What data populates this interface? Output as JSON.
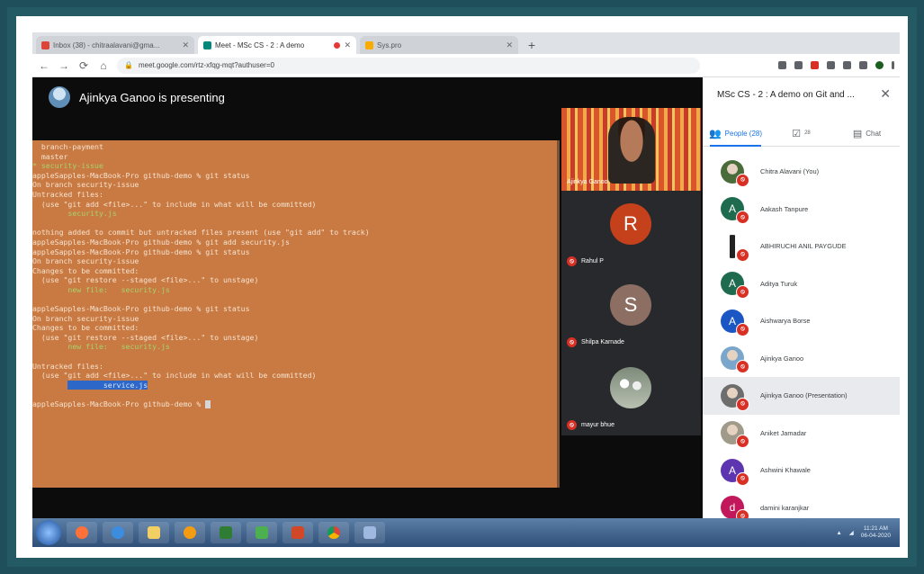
{
  "browser": {
    "tabs": [
      {
        "label": "Inbox (38) - chitraalavani@gma...",
        "favicon_color": "#db4437",
        "active": false
      },
      {
        "label": "Meet - MSc CS - 2 : A demo",
        "favicon_color": "#00897b",
        "active": true,
        "recording": true
      },
      {
        "label": "Sys.pro",
        "favicon_color": "#f9ab00",
        "active": false
      }
    ],
    "url": "meet.google.com/rtz-xfqg-mqt?authuser=0"
  },
  "meet": {
    "presenting_text": "Ajinkya Ganoo is presenting",
    "terminal_lines": [
      {
        "text": "  branch-payment",
        "style": "normal"
      },
      {
        "text": "  master",
        "style": "normal"
      },
      {
        "text": "* security-issue",
        "style": "green"
      },
      {
        "text": "appleSapples-MacBook-Pro github-demo % git status",
        "style": "normal"
      },
      {
        "text": "On branch security-issue",
        "style": "normal"
      },
      {
        "text": "Untracked files:",
        "style": "normal"
      },
      {
        "text": "  (use \"git add <file>...\" to include in what will be committed)",
        "style": "normal"
      },
      {
        "text": "        security.js",
        "style": "green"
      },
      {
        "text": "",
        "style": "normal"
      },
      {
        "text": "nothing added to commit but untracked files present (use \"git add\" to track)",
        "style": "normal"
      },
      {
        "text": "appleSapples-MacBook-Pro github-demo % git add security.js",
        "style": "normal"
      },
      {
        "text": "appleSapples-MacBook-Pro github-demo % git status",
        "style": "normal"
      },
      {
        "text": "On branch security-issue",
        "style": "normal"
      },
      {
        "text": "Changes to be committed:",
        "style": "normal"
      },
      {
        "text": "  (use \"git restore --staged <file>...\" to unstage)",
        "style": "normal"
      },
      {
        "text": "        new file:   security.js",
        "style": "green"
      },
      {
        "text": "",
        "style": "normal"
      },
      {
        "text": "appleSapples-MacBook-Pro github-demo % git status",
        "style": "normal"
      },
      {
        "text": "On branch security-issue",
        "style": "normal"
      },
      {
        "text": "Changes to be committed:",
        "style": "normal"
      },
      {
        "text": "  (use \"git restore --staged <file>...\" to unstage)",
        "style": "normal"
      },
      {
        "text": "        new file:   security.js",
        "style": "green"
      },
      {
        "text": "",
        "style": "normal"
      },
      {
        "text": "Untracked files:",
        "style": "normal"
      },
      {
        "text": "  (use \"git add <file>...\" to include in what will be committed)",
        "style": "normal"
      },
      {
        "text": "        service.js",
        "style": "highlight"
      },
      {
        "text": "",
        "style": "normal"
      },
      {
        "text": "appleSapples-MacBook-Pro github-demo % ",
        "style": "cursor"
      }
    ],
    "tiles": [
      {
        "name": "Ajinkya Ganoo",
        "type": "video"
      },
      {
        "name": "Rahul P",
        "initial": "R",
        "color": "#c5411c"
      },
      {
        "name": "Shilpa Karnade",
        "initial": "S",
        "color": "#8d6e63"
      },
      {
        "name": "mayur bhue",
        "type": "photo"
      }
    ]
  },
  "side_panel": {
    "title": "MSc CS - 2 : A demo on Git and ...",
    "tabs": [
      {
        "label": "People (28)",
        "icon": "people-icon",
        "active": true
      },
      {
        "label": "",
        "count": "28",
        "icon": "checklist-icon",
        "active": false
      },
      {
        "label": "Chat",
        "icon": "chat-icon",
        "active": false
      }
    ],
    "people": [
      {
        "name": "Chitra Alavani (You)",
        "initial": "",
        "color": "#4a6b3a",
        "photo": true
      },
      {
        "name": "Aakash Tanpure",
        "initial": "A",
        "color": "#1e6b4f"
      },
      {
        "name": "ABHIRUCHI ANIL PAYGUDE",
        "initial": "",
        "color": "#ffffff",
        "photo": true
      },
      {
        "name": "Aditya Turuk",
        "initial": "A",
        "color": "#1e6b4f"
      },
      {
        "name": "Aishwarya Borse",
        "initial": "A",
        "color": "#1a56c4"
      },
      {
        "name": "Ajinkya Ganoo",
        "initial": "",
        "color": "#7aa6cc",
        "photo": true
      },
      {
        "name": "Ajinkya Ganoo (Presentation)",
        "initial": "",
        "color": "#6d6d6d",
        "photo": true,
        "selected": true
      },
      {
        "name": "Aniket Jamadar",
        "initial": "",
        "color": "#a09a8a",
        "photo": true
      },
      {
        "name": "Ashwini Khawale",
        "initial": "A",
        "color": "#5e35b1"
      },
      {
        "name": "damini karanjkar",
        "initial": "d",
        "color": "#c2185b"
      }
    ]
  },
  "taskbar": {
    "clock_time": "11:21 AM",
    "clock_date": "06-04-2020"
  }
}
